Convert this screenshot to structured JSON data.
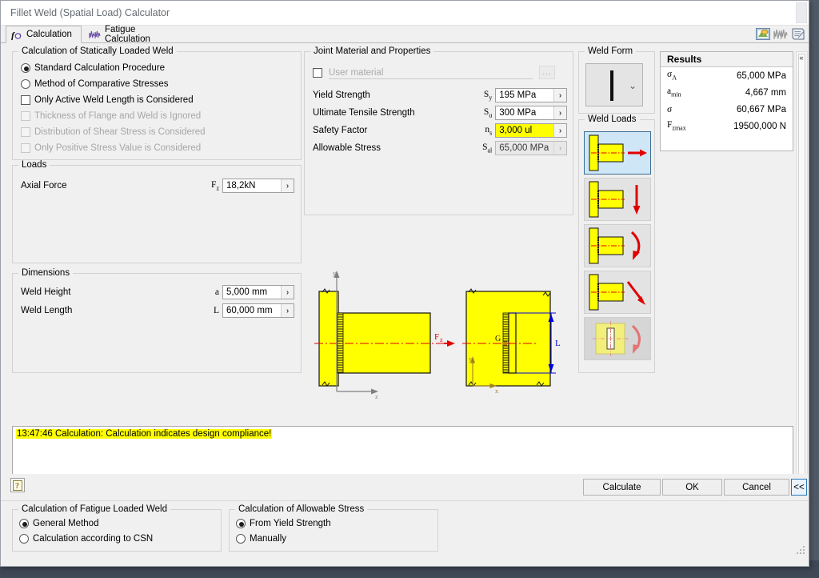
{
  "window": {
    "title": "Fillet Weld (Spatial Load) Calculator"
  },
  "tabs": [
    {
      "label": "Calculation",
      "icon": "function-icon",
      "active": true
    },
    {
      "label": "Fatigue Calculation",
      "icon": "chart-wave-icon",
      "active": false
    }
  ],
  "toolbar_icons": [
    {
      "name": "export-image-icon"
    },
    {
      "name": "chart-wave-icon"
    },
    {
      "name": "notepad-icon"
    }
  ],
  "static_weld_group": {
    "legend": "Calculation of Statically Loaded Weld",
    "options": [
      {
        "type": "radio",
        "label": "Standard Calculation Procedure",
        "checked": true,
        "enabled": true
      },
      {
        "type": "radio",
        "label": "Method of Comparative Stresses",
        "checked": false,
        "enabled": true
      },
      {
        "type": "checkbox",
        "label": "Only Active Weld Length is Considered",
        "checked": false,
        "enabled": true
      },
      {
        "type": "checkbox",
        "label": "Thickness of Flange and Weld is Ignored",
        "checked": false,
        "enabled": false
      },
      {
        "type": "checkbox",
        "label": "Distribution of Shear Stress is Considered",
        "checked": false,
        "enabled": false
      },
      {
        "type": "checkbox",
        "label": "Only Positive Stress Value is Considered",
        "checked": false,
        "enabled": false
      }
    ]
  },
  "loads_group": {
    "legend": "Loads",
    "rows": [
      {
        "label": "Axial Force",
        "symbol": "F",
        "sub": "z",
        "value": "18,2kN",
        "highlight": false,
        "readonly": false
      }
    ]
  },
  "dimensions_group": {
    "legend": "Dimensions",
    "rows": [
      {
        "label": "Weld Height",
        "symbol": "a",
        "sub": "",
        "value": "5,000 mm",
        "highlight": false,
        "readonly": false
      },
      {
        "label": "Weld Length",
        "symbol": "L",
        "sub": "",
        "value": "60,000 mm",
        "highlight": false,
        "readonly": false
      }
    ]
  },
  "material_group": {
    "legend": "Joint Material and Properties",
    "user_material_checkbox_checked": false,
    "user_material_placeholder": "User material",
    "browse_label": "...",
    "rows": [
      {
        "label": "Yield Strength",
        "symbol": "S",
        "sub": "y",
        "value": "195 MPa",
        "highlight": false,
        "readonly": false
      },
      {
        "label": "Ultimate Tensile Strength",
        "symbol": "S",
        "sub": "u",
        "value": "300 MPa",
        "highlight": false,
        "readonly": false
      },
      {
        "label": "Safety Factor",
        "symbol": "n",
        "sub": "s",
        "value": "3,000 ul",
        "highlight": true,
        "readonly": false
      },
      {
        "label": "Allowable Stress",
        "symbol": "S",
        "sub": "al",
        "value": "65,000 MPa",
        "highlight": false,
        "readonly": true
      }
    ]
  },
  "weld_form_group": {
    "legend": "Weld Form",
    "selected_icon": "single-bar-weld-icon",
    "dropdown_icon": "chevron-down-icon"
  },
  "weld_loads_group": {
    "legend": "Weld Loads",
    "items": [
      {
        "name": "weld-load-axial-force",
        "selected": true,
        "enabled": true,
        "arrow": "right"
      },
      {
        "name": "weld-load-shear-force",
        "selected": false,
        "enabled": true,
        "arrow": "down"
      },
      {
        "name": "weld-load-bending-moment",
        "selected": false,
        "enabled": true,
        "arrow": "curve"
      },
      {
        "name": "weld-load-combined-force",
        "selected": false,
        "enabled": true,
        "arrow": "diagonal"
      },
      {
        "name": "weld-load-torsion-moment",
        "selected": false,
        "enabled": false,
        "arrow": "curve"
      }
    ]
  },
  "results": {
    "title": "Results",
    "rows": [
      {
        "symbol": "σ",
        "sub": "A",
        "value": "65,000 MPa"
      },
      {
        "symbol": "a",
        "sub": "min",
        "value": "4,667 mm"
      },
      {
        "symbol": "σ",
        "sub": "",
        "value": "60,667 MPa"
      },
      {
        "symbol": "F",
        "sub": "zmax",
        "value": "19500,000 N"
      }
    ]
  },
  "diagram": {
    "side_view": {
      "axis_y_label": "y",
      "axis_z_label": "z",
      "force_label": "F",
      "force_sub": "z"
    },
    "front_view": {
      "centroid_label": "G",
      "length_label": "L",
      "axis_y_label": "y",
      "axis_x_label": "x"
    }
  },
  "log": {
    "message": "13:47:46 Calculation: Calculation indicates design compliance!"
  },
  "buttons": {
    "help": "?",
    "calculate": "Calculate",
    "ok": "OK",
    "cancel": "Cancel",
    "collapse": "<<"
  },
  "fatigue_group": {
    "legend": "Calculation of Fatigue Loaded Weld",
    "options": [
      {
        "label": "General Method",
        "checked": true
      },
      {
        "label": "Calculation according to CSN",
        "checked": false
      }
    ]
  },
  "allowable_group": {
    "legend": "Calculation of Allowable Stress",
    "options": [
      {
        "label": "From Yield Strength",
        "checked": true
      },
      {
        "label": "Manually",
        "checked": false
      }
    ]
  },
  "colors": {
    "highlight": "#ffff00",
    "selection": "#cfe6f7",
    "weld_yellow": "#ffff00",
    "arrow_red": "#e00000",
    "dimension_blue": "#0000e0",
    "accent_border": "#2a77b8"
  }
}
